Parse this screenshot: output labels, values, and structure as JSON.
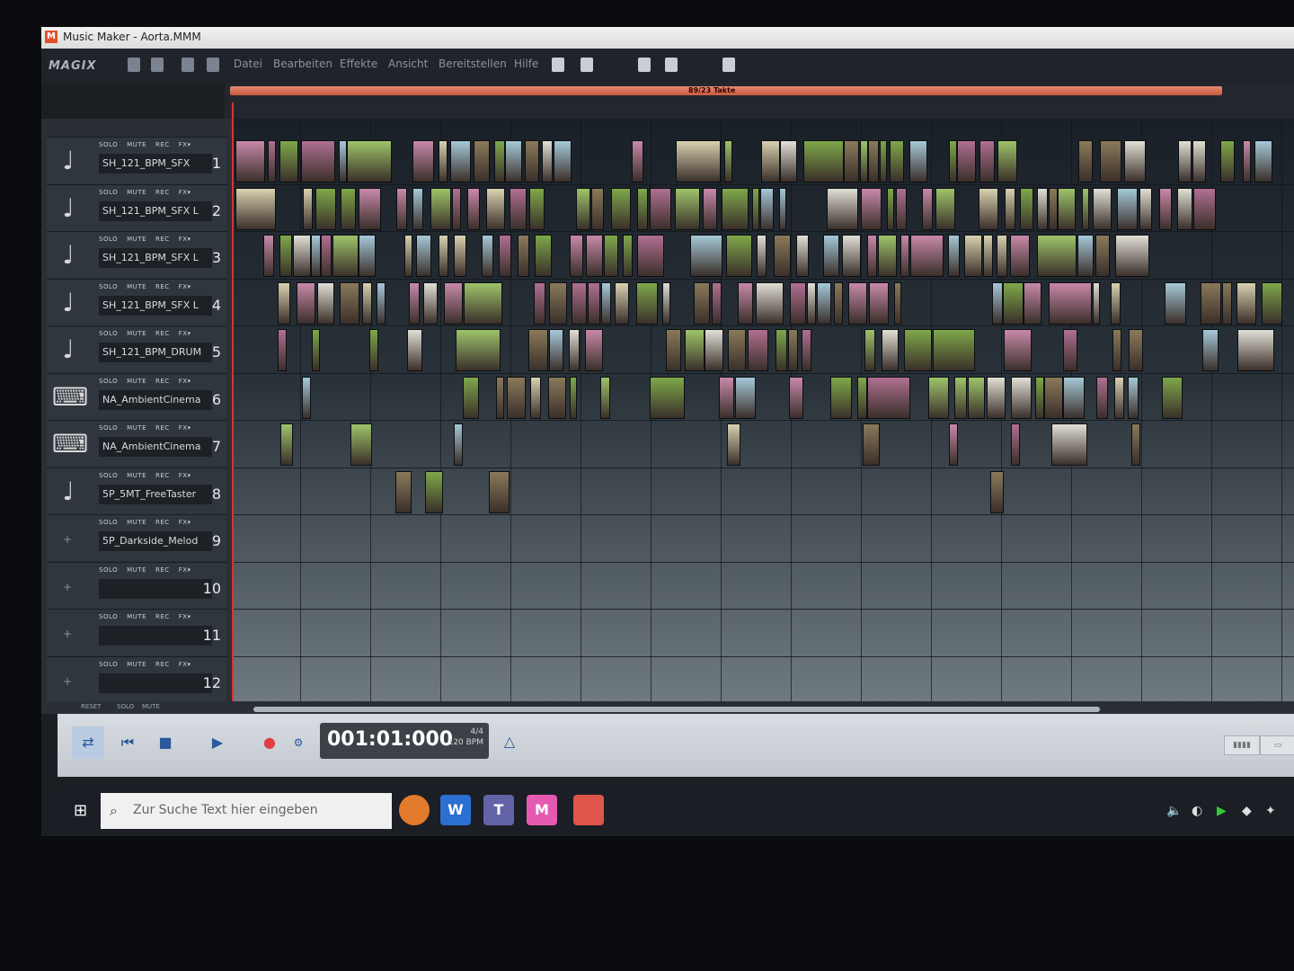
{
  "window": {
    "title": "Music Maker - Aorta.MMM"
  },
  "brand": "MAGIX",
  "menu": [
    "Datei",
    "Bearbeiten",
    "Effekte",
    "Ansicht",
    "Bereitstellen",
    "Hilfe"
  ],
  "ruler": {
    "loop_label": "89/23 Takte"
  },
  "track_buttons": {
    "solo": "SOLO",
    "mute": "MUTE",
    "rec": "REC",
    "fx": "FX▾"
  },
  "tracks": [
    {
      "name": "SH_121_BPM_SFX",
      "number": "1",
      "icon": "note-icon"
    },
    {
      "name": "SH_121_BPM_SFX L",
      "number": "2",
      "icon": "note-icon"
    },
    {
      "name": "SH_121_BPM_SFX L",
      "number": "3",
      "icon": "note-icon"
    },
    {
      "name": "SH_121_BPM_SFX L",
      "number": "4",
      "icon": "note-icon"
    },
    {
      "name": "SH_121_BPM_DRUM",
      "number": "5",
      "icon": "note-icon"
    },
    {
      "name": "NA_AmbientCinema",
      "number": "6",
      "icon": "keyboard-icon"
    },
    {
      "name": "NA_AmbientCinema",
      "number": "7",
      "icon": "keyboard-icon"
    },
    {
      "name": "5P_5MT_FreeTaster",
      "number": "8",
      "icon": "note-icon"
    },
    {
      "name": "5P_Darkside_Melod",
      "number": "9",
      "icon": "add-icon"
    },
    {
      "name": "",
      "number": "10",
      "icon": "add-icon"
    },
    {
      "name": "",
      "number": "11",
      "icon": "add-icon"
    },
    {
      "name": "",
      "number": "12",
      "icon": "add-icon"
    }
  ],
  "bottom_strip": {
    "reset": "RESET",
    "solo": "SOLO",
    "mute": "MUTE"
  },
  "transport": {
    "time": "001:01:000",
    "time_signature": "4/4",
    "tempo": "120 BPM"
  },
  "taskbar": {
    "search_placeholder": "Zur Suche Text hier eingeben",
    "apps": [
      "firefox-icon",
      "word-icon",
      "teams-icon",
      "music-maker-icon",
      "app-icon"
    ]
  },
  "colors": {
    "accent_loop": "#d9694c",
    "playhead": "#e03030",
    "clip_green": "#7fa84a",
    "clip_pink": "#c889a8"
  }
}
